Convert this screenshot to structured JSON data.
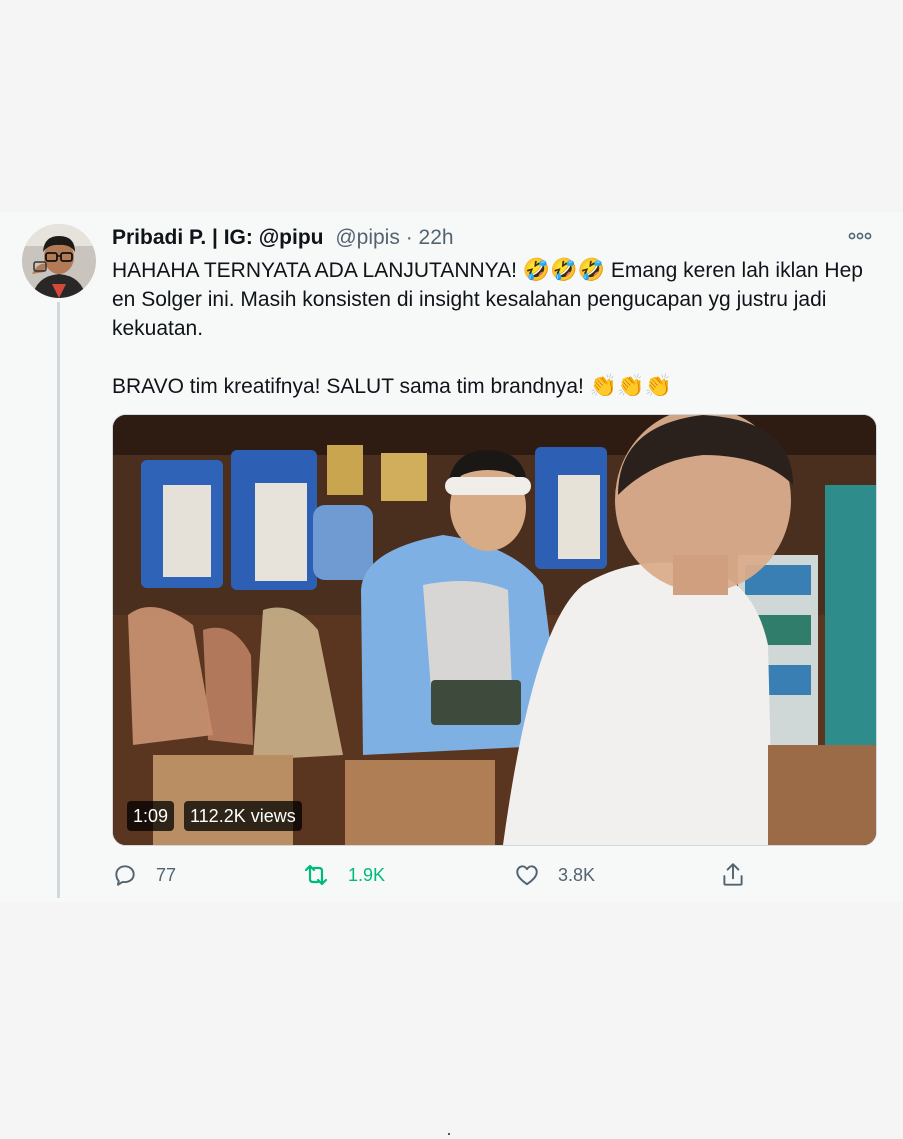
{
  "tweet": {
    "author_name": "Pribadi P. | IG: @pipu",
    "handle": "@pipis",
    "separator": "·",
    "time": "22h",
    "text_line1": "HAHAHA TERNYATA ADA LANJUTANNYA!",
    "text_line1_emoji": "🤣🤣🤣",
    "text_line1_rest": "Emang keren lah iklan Hep en Solger ini. Masih konsisten di insight kesalahan pengucapan yg justru jadi kekuatan.",
    "text_line2": "BRAVO tim kreatifnya! SALUT sama tim brandnya!",
    "text_line2_emoji": "👏👏👏"
  },
  "video": {
    "duration": "1:09",
    "views": "112.2K views"
  },
  "actions": {
    "reply_count": "77",
    "retweet_count": "1.9K",
    "like_count": "3.8K"
  },
  "colors": {
    "retweet_active": "#00ba7c",
    "secondary_text": "#536471"
  }
}
